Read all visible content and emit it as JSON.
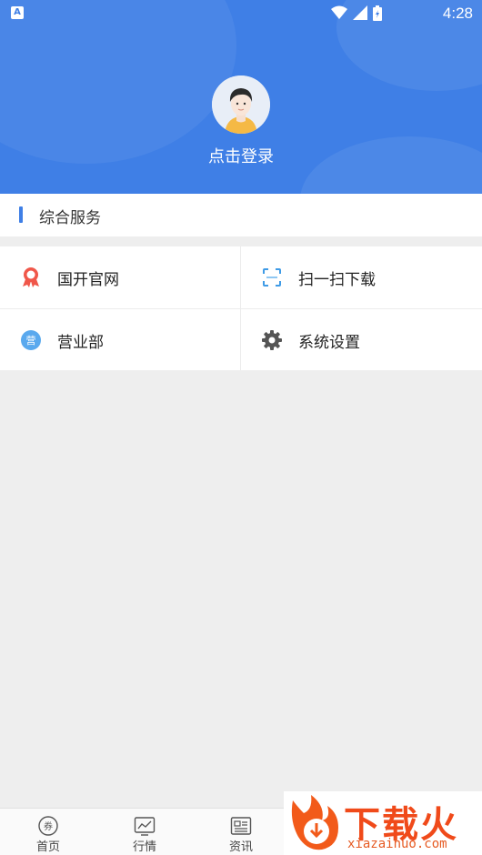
{
  "status_bar": {
    "time": "4:28",
    "icons": [
      "app-a-icon",
      "wifi-icon",
      "signal-icon",
      "battery-icon"
    ]
  },
  "header": {
    "login_label": "点击登录"
  },
  "section": {
    "title": "综合服务"
  },
  "services": [
    {
      "label": "国开官网",
      "icon": "ribbon-icon",
      "color": "#f0574a"
    },
    {
      "label": "扫一扫下载",
      "icon": "scan-icon",
      "color": "#3f9be6"
    },
    {
      "label": "营业部",
      "icon": "branch-icon",
      "color": "#5aa9ee",
      "icon_text": "营"
    },
    {
      "label": "系统设置",
      "icon": "gear-icon",
      "color": "#555555"
    }
  ],
  "bottom_nav": [
    {
      "label": "首页",
      "icon": "home-coupon-icon"
    },
    {
      "label": "行情",
      "icon": "market-chart-icon"
    },
    {
      "label": "资讯",
      "icon": "news-icon"
    }
  ],
  "watermark": {
    "text": "下载火",
    "url": "xiazaihuo.com"
  },
  "colors": {
    "primary": "#3f7fe6",
    "background": "#eeeeee"
  }
}
